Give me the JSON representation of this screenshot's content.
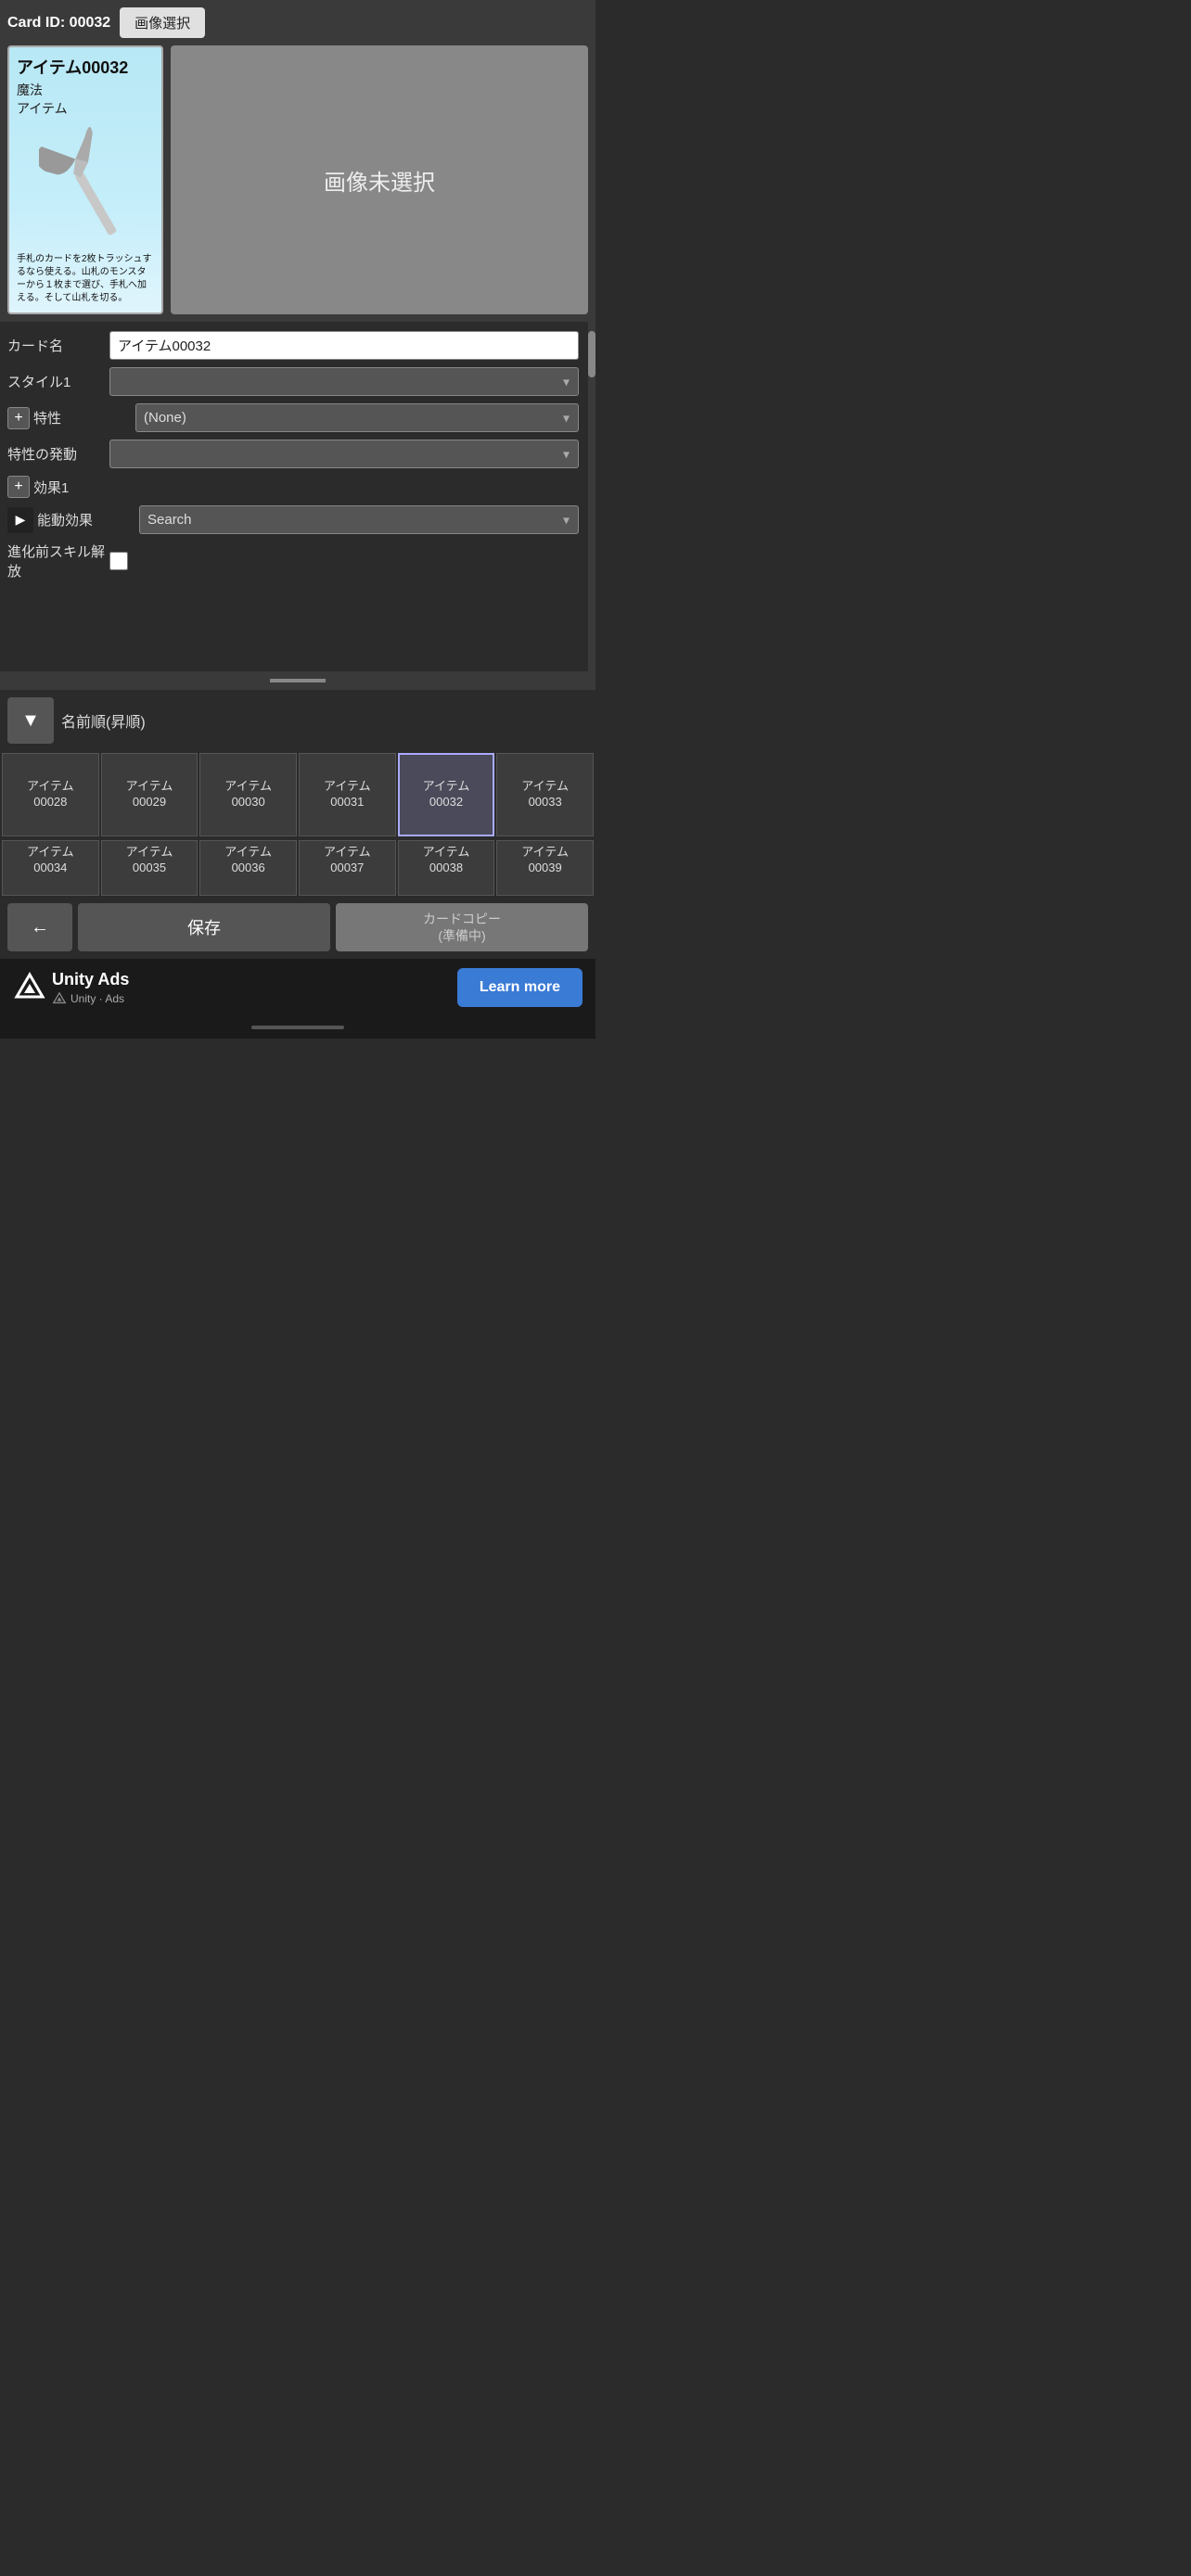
{
  "header": {
    "card_id_label": "Card ID: 00032",
    "image_select_btn": "画像選択"
  },
  "card_preview": {
    "title": "アイテム00032",
    "type1": "魔法",
    "type2": "アイテム",
    "description": "手札のカードを2枚トラッシュするなら使える。山札のモンスターから１枚まで選び、手札へ加える。そして山札を切る。",
    "no_image_text": "画像未選択"
  },
  "form": {
    "card_name_label": "カード名",
    "card_name_value": "アイテム00032",
    "style1_label": "スタイル1",
    "style1_value": "",
    "trait_label": "特性",
    "trait_value": "(None)",
    "trait_trigger_label": "特性の発動",
    "trait_trigger_value": "",
    "effect1_label": "効果1",
    "active_effect_label": "能動効果",
    "active_effect_placeholder": "Search",
    "pre_skill_label": "進化前スキル解放"
  },
  "sort": {
    "sort_btn_label": "▼",
    "sort_label": "名前順(昇順)"
  },
  "grid": {
    "row1": [
      {
        "label": "アイテム\n00028"
      },
      {
        "label": "アイテム\n00029"
      },
      {
        "label": "アイテム\n00030"
      },
      {
        "label": "アイテム\n00031"
      },
      {
        "label": "アイテム\n00032",
        "selected": true
      },
      {
        "label": "アイテム\n00033"
      }
    ],
    "row2": [
      {
        "label": "アイテム\n00034"
      },
      {
        "label": "アイテム\n00035"
      },
      {
        "label": "アイテム\n00036"
      },
      {
        "label": "アイテム\n00037"
      },
      {
        "label": "アイテム\n00038"
      },
      {
        "label": "アイテム\n00039"
      }
    ]
  },
  "buttons": {
    "back_btn": "←",
    "save_btn": "保存",
    "copy_btn": "カードコピー\n(準備中)"
  },
  "ad": {
    "brand": "Unity Ads",
    "brand_small": "Unity · Ads",
    "learn_more": "Learn more"
  }
}
